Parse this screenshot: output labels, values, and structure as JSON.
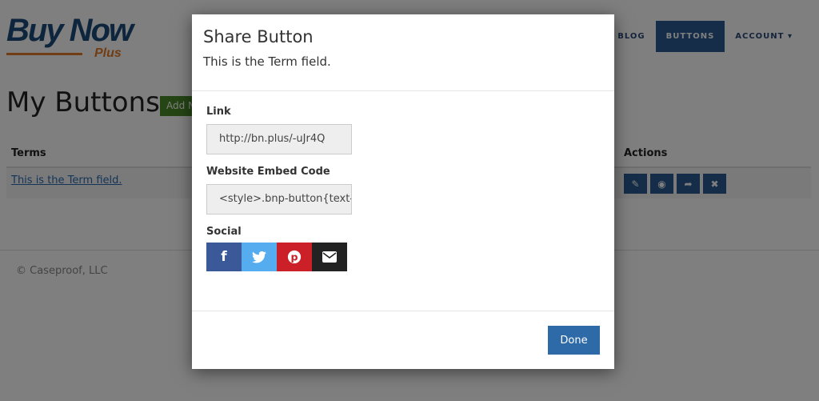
{
  "logo": {
    "text": "Buy Now",
    "sub": "Plus"
  },
  "nav": [
    {
      "label": "BLOG"
    },
    {
      "label": "BUTTONS"
    },
    {
      "label": "ACCOUNT ▾"
    }
  ],
  "page": {
    "title": "My Buttons",
    "add_label": "Add New"
  },
  "table": {
    "headers": [
      "Terms",
      "Actions"
    ],
    "rows": [
      {
        "term": "This is the Term field."
      }
    ],
    "actions": [
      "pencil-icon",
      "eye-icon",
      "share-icon",
      "close-icon"
    ]
  },
  "footer": "© Caseproof, LLC",
  "modal": {
    "title": "Share Button",
    "subtitle": "This is the Term field.",
    "link_label": "Link",
    "link_value": "http://bn.plus/-uJr4Q",
    "embed_label": "Website Embed Code",
    "embed_value": "<style>.bnp-button{text-",
    "social_label": "Social",
    "social": [
      {
        "name": "facebook",
        "glyph": "f",
        "color": "#3b5998"
      },
      {
        "name": "twitter",
        "glyph": "🐦",
        "color": "#55acee"
      },
      {
        "name": "pinterest",
        "glyph": "℗",
        "color": "#cb2027"
      },
      {
        "name": "email",
        "glyph": "✉",
        "color": "#222222"
      }
    ],
    "done_label": "Done"
  }
}
